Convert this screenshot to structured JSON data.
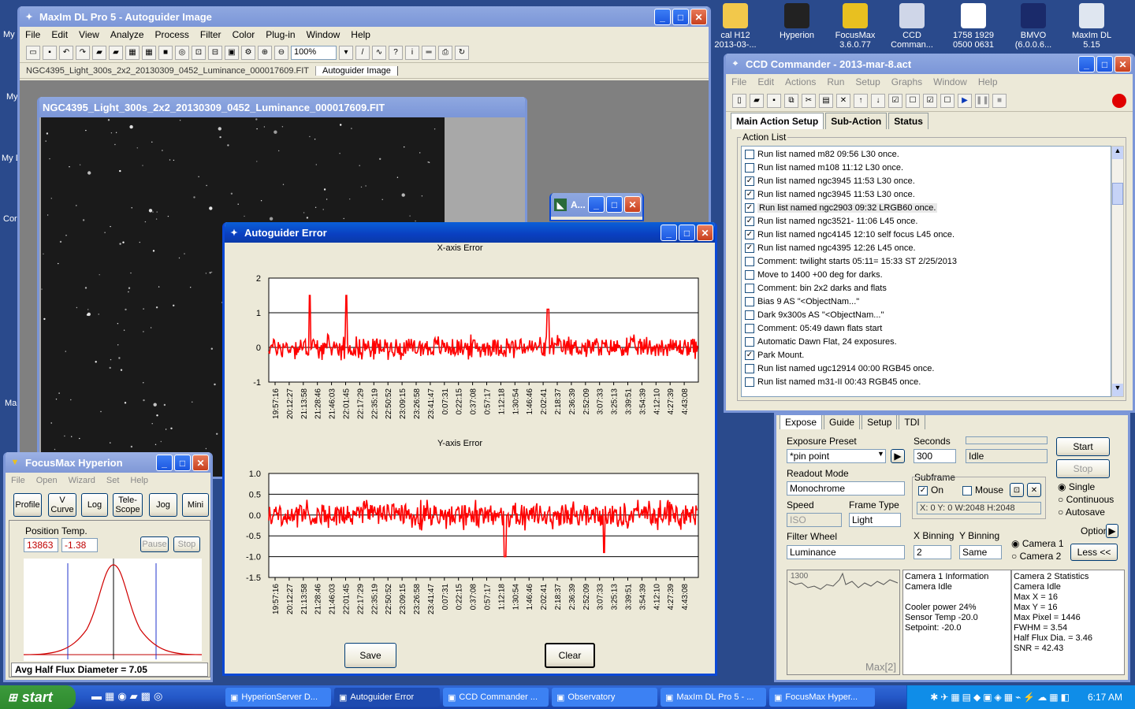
{
  "desktop": {
    "left_labels": [
      "My",
      "My",
      "My D",
      "Cor",
      "Ma"
    ],
    "icons": [
      {
        "label": "cal H12\n2013-03-...",
        "icon": "folder-icon",
        "color": "#f2c84b"
      },
      {
        "label": "Hyperion",
        "icon": "hyperion-icon",
        "color": "#222"
      },
      {
        "label": "FocusMax\n3.6.0.77",
        "icon": "focusmax-icon",
        "color": "#e8c020"
      },
      {
        "label": "CCD\nComman...",
        "icon": "telescope-icon",
        "color": "#cfd6e8"
      },
      {
        "label": "1758 1929\n0500 0631",
        "icon": "document-icon",
        "color": "#ffffff"
      },
      {
        "label": "BMVO\n(6.0.0.6...",
        "icon": "bmvo-icon",
        "color": "#1a2a6a"
      },
      {
        "label": "MaxIm DL\n5.15",
        "icon": "maxim-icon",
        "color": "#dfe6f0"
      }
    ]
  },
  "maxim": {
    "title": "MaxIm DL Pro 5 - Autoguider Image",
    "menu": [
      "File",
      "Edit",
      "View",
      "Analyze",
      "Process",
      "Filter",
      "Color",
      "Plug-in",
      "Window",
      "Help"
    ],
    "zoom": "100%",
    "doc_tabs": [
      "NGC4395_Light_300s_2x2_20130309_0452_Luminance_000017609.FIT",
      "Autoguider Image"
    ],
    "image_window_title": "NGC4395_Light_300s_2x2_20130309_0452_Luminance_000017609.FIT",
    "mini_window_title": "A..."
  },
  "autoguider": {
    "title": "Autoguider Error",
    "save_label": "Save",
    "clear_label": "Clear"
  },
  "chart_data": [
    {
      "type": "line",
      "title": "X-axis Error",
      "series": [
        {
          "color": "#ff0000"
        }
      ],
      "ylim": [
        -1,
        2
      ],
      "yticks": [
        "2",
        "1",
        "0",
        "-1"
      ],
      "x_tick_labels": [
        "19:57:16",
        "20:12:27",
        "21:13:58",
        "21:28:46",
        "21:46:03",
        "22:01:45",
        "22:17:29",
        "22:35:19",
        "22:50:52",
        "23:09:15",
        "23:26:58",
        "23:41:47",
        "0:07:31",
        "0:22:15",
        "0:37:08",
        "0:57:17",
        "1:12:18",
        "1:30:54",
        "1:46:46",
        "2:02:41",
        "2:18:37",
        "2:36:39",
        "2:52:09",
        "3:07:33",
        "3:25:13",
        "3:39:51",
        "3:54:39",
        "4:12:10",
        "4:27:39",
        "4:43:08"
      ],
      "noise_amplitude": 0.25,
      "spikes": [
        [
          0.095,
          1.5
        ],
        [
          0.18,
          1.5
        ],
        [
          0.65,
          1.1
        ]
      ]
    },
    {
      "type": "line",
      "title": "Y-axis Error",
      "series": [
        {
          "color": "#ff0000"
        }
      ],
      "ylim": [
        -1.5,
        1.0
      ],
      "yticks": [
        "1.0",
        "0.5",
        "0.0",
        "-0.5",
        "-1.0",
        "-1.5"
      ],
      "x_tick_labels": [
        "19:57:16",
        "20:12:27",
        "21:13:58",
        "21:28:46",
        "21:46:03",
        "22:01:45",
        "22:17:29",
        "22:35:19",
        "22:50:52",
        "23:09:15",
        "23:26:58",
        "23:41:47",
        "0:07:31",
        "0:22:15",
        "0:37:08",
        "0:57:17",
        "1:12:18",
        "1:30:54",
        "1:46:46",
        "2:02:41",
        "2:18:37",
        "2:36:39",
        "2:52:09",
        "3:07:33",
        "3:25:13",
        "3:39:51",
        "3:54:39",
        "4:12:10",
        "4:27:39",
        "4:43:08"
      ],
      "noise_amplitude": 0.25,
      "spikes": [
        [
          0.55,
          -1.0
        ],
        [
          0.78,
          -0.9
        ]
      ]
    }
  ],
  "ccd": {
    "title": "CCD Commander - 2013-mar-8.act",
    "menu": [
      "File",
      "Edit",
      "Actions",
      "Run",
      "Setup",
      "Graphs",
      "Window",
      "Help"
    ],
    "tabs": [
      "Main Action Setup",
      "Sub-Action",
      "Status"
    ],
    "group_label": "Action List",
    "actions": [
      {
        "checked": false,
        "text": "Run list named m82 09:56 L30 once."
      },
      {
        "checked": false,
        "text": "Run list named m108 11:12 L30 once."
      },
      {
        "checked": true,
        "text": "Run list named ngc3945 11:53 L30 once."
      },
      {
        "checked": true,
        "text": "Run list named ngc3945 11:53 L30 once."
      },
      {
        "checked": true,
        "text": "Run list named ngc2903 09:32 LRGB60 once.",
        "selected": true
      },
      {
        "checked": true,
        "text": "Run list named ngc3521- 11:06 L45 once."
      },
      {
        "checked": true,
        "text": "Run list named ngc4145 12:10 self focus L45 once."
      },
      {
        "checked": true,
        "text": "Run list named ngc4395 12:26 L45 once."
      },
      {
        "checked": false,
        "text": "Comment: twilight starts 05:11= 15:33 ST   2/25/2013"
      },
      {
        "checked": false,
        "text": "Move to 1400 +00 deg for darks."
      },
      {
        "checked": false,
        "text": "Comment: bin 2x2 darks and flats"
      },
      {
        "checked": false,
        "text": "Bias 9 AS \"<ObjectNam...\""
      },
      {
        "checked": false,
        "text": "Dark 9x300s AS \"<ObjectNam...\""
      },
      {
        "checked": false,
        "text": "Comment: 05:49 dawn flats start"
      },
      {
        "checked": false,
        "text": "Automatic Dawn Flat, 24 exposures."
      },
      {
        "checked": true,
        "text": "Park Mount."
      },
      {
        "checked": false,
        "text": "Run list named ugc12914 00:00 RGB45 once."
      },
      {
        "checked": false,
        "text": "Run list named m31-II 00:43 RGB45 once."
      }
    ]
  },
  "camera": {
    "tabs": [
      "Expose",
      "Guide",
      "Setup",
      "TDI"
    ],
    "exposure_preset_label": "Exposure Preset",
    "exposure_preset": "*pin point",
    "seconds_label": "Seconds",
    "seconds": "300",
    "status": "Idle",
    "start_label": "Start",
    "stop_label": "Stop",
    "readout_label": "Readout Mode",
    "readout": "Monochrome",
    "subframe_label": "Subframe",
    "subframe_on": "On",
    "subframe_mouse": "Mouse",
    "subframe_coords": "X:   0 Y:   0 W:2048 H:2048",
    "speed_label": "Speed",
    "speed": "ISO",
    "frame_type_label": "Frame Type",
    "frame_type": "Light",
    "mode_single": "Single",
    "mode_continuous": "Continuous",
    "mode_autosave": "Autosave",
    "options_label": "Options",
    "filter_wheel_label": "Filter Wheel",
    "filter": "Luminance",
    "xbin_label": "X Binning",
    "xbin": "2",
    "ybin_label": "Y Binning",
    "ybin": "Same",
    "camera1": "Camera 1",
    "camera2": "Camera 2",
    "less_label": "Less <<",
    "graph_top": "1300",
    "graph_bottom": "Max[2]",
    "cam1_info": [
      "Camera 1 Information",
      "Camera Idle",
      "",
      "Cooler power 24%",
      "Sensor Temp -20.0",
      "Setpoint: -20.0"
    ],
    "cam2_info": [
      "Camera 2 Statistics",
      "Camera Idle",
      "Max X = 16",
      "Max Y = 16",
      "Max Pixel = 1446",
      "FWHM = 3.54",
      "Half Flux Dia. = 3.46",
      "SNR = 42.43"
    ]
  },
  "focusmax": {
    "title": "FocusMax  Hyperion",
    "menu": [
      "File",
      "Open",
      "Wizard",
      "Set",
      "Help"
    ],
    "buttons": [
      "Profile",
      "V\nCurve",
      "Log",
      "Tele-\nScope",
      "Jog",
      "Mini"
    ],
    "position_label": "Position",
    "temp_label": "Temp.",
    "position": "13863",
    "temp": "-1.38",
    "pause_label": "Pause",
    "stop_label": "Stop",
    "hfd": "Avg Half Flux Diameter = 7.05"
  },
  "taskbar": {
    "start": "start",
    "tasks": [
      "HyperionServer D...",
      "Autoguider Error",
      "CCD Commander ...",
      "Observatory",
      "MaxIm DL Pro 5 - ...",
      "FocusMax  Hyper..."
    ],
    "clock": "6:17 AM"
  }
}
